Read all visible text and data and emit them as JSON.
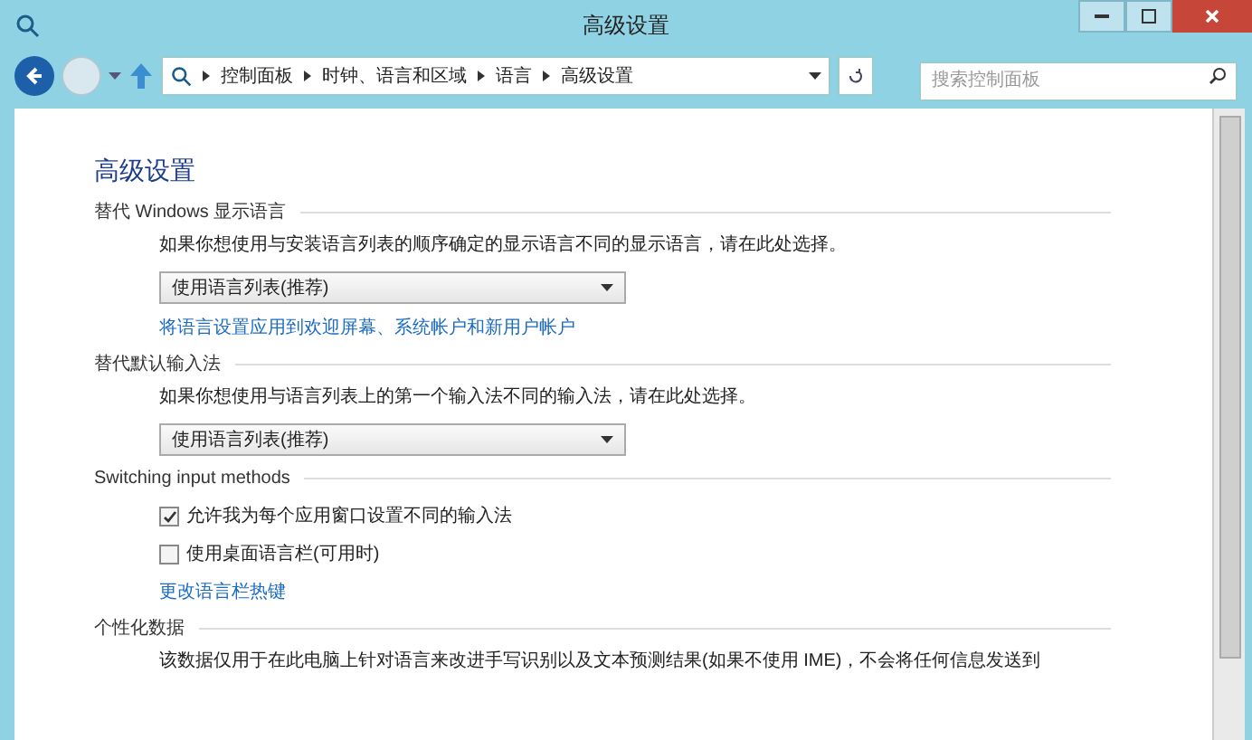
{
  "window": {
    "title": "高级设置"
  },
  "address_bar": {
    "breadcrumbs": [
      "控制面板",
      "时钟、语言和区域",
      "语言",
      "高级设置"
    ]
  },
  "search": {
    "placeholder": "搜索控制面板"
  },
  "page_title": "高级设置",
  "sections": [
    {
      "kind": "dropdown",
      "title": "替代 Windows 显示语言",
      "description": "如果你想使用与安装语言列表的顺序确定的显示语言不同的显示语言，请在此处选择。",
      "dropdown": "使用语言列表(推荐)",
      "link": "将语言设置应用到欢迎屏幕、系统帐户和新用户帐户"
    },
    {
      "kind": "dropdown",
      "title": "替代默认输入法",
      "description": "如果你想使用与语言列表上的第一个输入法不同的输入法，请在此处选择。",
      "dropdown": "使用语言列表(推荐)"
    },
    {
      "kind": "checkboxes",
      "title": "Switching input methods",
      "checkboxes": [
        {
          "label": "允许我为每个应用窗口设置不同的输入法",
          "checked": true
        },
        {
          "label": "使用桌面语言栏(可用时)",
          "checked": false
        }
      ],
      "link": "更改语言栏热键"
    },
    {
      "kind": "text",
      "title": "个性化数据",
      "description": "该数据仅用于在此电脑上针对语言来改进手写识别以及文本预测结果(如果不使用 IME)，不会将任何信息发送到"
    }
  ]
}
